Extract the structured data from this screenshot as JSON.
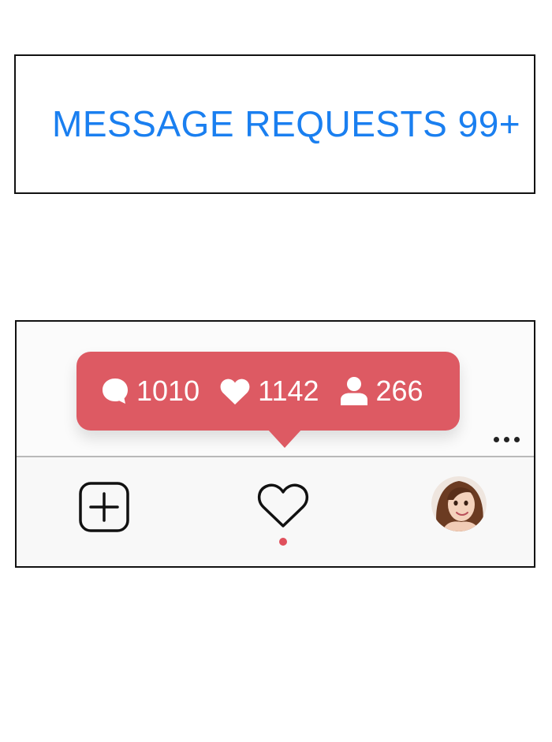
{
  "message_requests": {
    "text": "MESSAGE REQUESTS 99+",
    "color": "#1a7ff0"
  },
  "notification": {
    "bubble_color": "#dd5a63",
    "items": [
      {
        "icon": "comment-icon",
        "count": "1010"
      },
      {
        "icon": "heart-icon",
        "count": "1142"
      },
      {
        "icon": "person-icon",
        "count": "266"
      }
    ]
  },
  "tab_bar": {
    "items": [
      {
        "icon": "add-post-icon"
      },
      {
        "icon": "heart-outline-icon",
        "has_activity_dot": true
      },
      {
        "icon": "profile-avatar"
      }
    ],
    "activity_dot_color": "#e0505c"
  },
  "overflow_menu": {
    "icon": "more-dots-icon"
  }
}
